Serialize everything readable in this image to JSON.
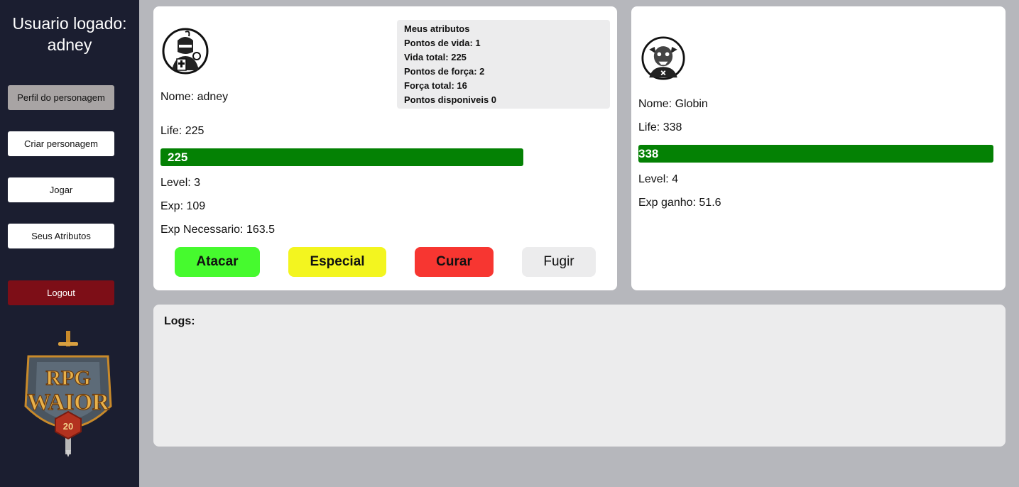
{
  "sidebar": {
    "user_label": "Usuario logado:",
    "username": "adney",
    "menu": {
      "perfil": "Perfil do personagem",
      "criar": "Criar personagem",
      "jogar": "Jogar",
      "atributos": "Seus Atributos",
      "logout": "Logout"
    },
    "logo": {
      "line1": "RPG",
      "line2": "WAIOR",
      "die": "20"
    }
  },
  "player": {
    "nome": "Nome: adney",
    "life": "Life: 225",
    "life_bar_value": "225",
    "life_fraction": 1.0,
    "level": "Level: 3",
    "exp": "Exp: 109",
    "exp_necessario": "Exp Necessario: 163.5",
    "attributes": {
      "title": "Meus atributos",
      "pontos_vida": "Pontos de vida: 1",
      "vida_total": "Vida total: 225",
      "pontos_forca": "Pontos de força: 2",
      "forca_total": "Força total: 16",
      "pontos_disponiveis": "Pontos disponiveis 0"
    }
  },
  "actions": {
    "atacar": "Atacar",
    "especial": "Especial",
    "curar": "Curar",
    "fugir": "Fugir"
  },
  "enemy": {
    "nome": "Nome: Globin",
    "life": "Life: 338",
    "life_bar_value": "338",
    "life_fraction": 1.0,
    "level": "Level: 4",
    "exp_ganho": "Exp ganho: 51.6"
  },
  "logs": {
    "title": "Logs:"
  },
  "colors": {
    "sidebar_bg": "#1b1e30",
    "life_bar": "#048104",
    "atacar": "#46fa2e",
    "especial": "#f3f51f",
    "curar": "#f73631",
    "fugir": "#ececed",
    "logout": "#7d0e17"
  }
}
